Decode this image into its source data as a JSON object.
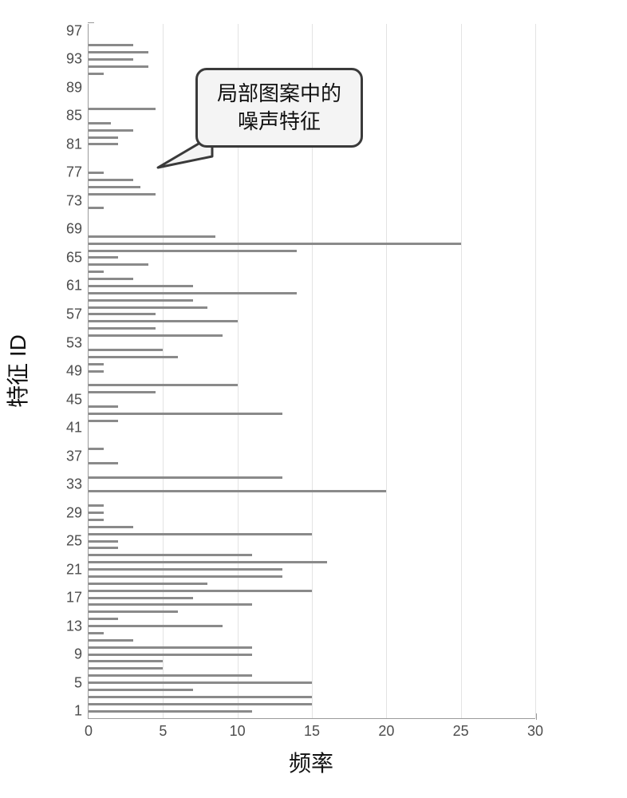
{
  "chart_data": {
    "type": "bar",
    "orientation": "horizontal",
    "title": "",
    "xlabel": "频率",
    "ylabel": "特征 ID",
    "xlim": [
      0,
      30
    ],
    "xticks": [
      0,
      5,
      10,
      15,
      20,
      25,
      30
    ],
    "ylim": [
      0,
      98
    ],
    "yticks": [
      1,
      5,
      9,
      13,
      17,
      21,
      25,
      29,
      33,
      37,
      41,
      45,
      49,
      53,
      57,
      61,
      65,
      69,
      73,
      77,
      81,
      85,
      89,
      93,
      97
    ],
    "series": [
      {
        "name": "frequency",
        "values": [
          {
            "id": 1,
            "v": 11
          },
          {
            "id": 2,
            "v": 15
          },
          {
            "id": 3,
            "v": 15
          },
          {
            "id": 4,
            "v": 7
          },
          {
            "id": 5,
            "v": 15
          },
          {
            "id": 6,
            "v": 11
          },
          {
            "id": 7,
            "v": 5
          },
          {
            "id": 8,
            "v": 5
          },
          {
            "id": 9,
            "v": 11
          },
          {
            "id": 10,
            "v": 11
          },
          {
            "id": 11,
            "v": 3
          },
          {
            "id": 12,
            "v": 1
          },
          {
            "id": 13,
            "v": 9
          },
          {
            "id": 14,
            "v": 2
          },
          {
            "id": 15,
            "v": 6
          },
          {
            "id": 16,
            "v": 11
          },
          {
            "id": 17,
            "v": 7
          },
          {
            "id": 18,
            "v": 15
          },
          {
            "id": 19,
            "v": 8
          },
          {
            "id": 20,
            "v": 13
          },
          {
            "id": 21,
            "v": 13
          },
          {
            "id": 22,
            "v": 16
          },
          {
            "id": 23,
            "v": 11
          },
          {
            "id": 24,
            "v": 2
          },
          {
            "id": 25,
            "v": 2
          },
          {
            "id": 26,
            "v": 15
          },
          {
            "id": 27,
            "v": 3
          },
          {
            "id": 28,
            "v": 1
          },
          {
            "id": 29,
            "v": 1
          },
          {
            "id": 30,
            "v": 1
          },
          {
            "id": 31,
            "v": 0
          },
          {
            "id": 32,
            "v": 20
          },
          {
            "id": 33,
            "v": 0
          },
          {
            "id": 34,
            "v": 13
          },
          {
            "id": 35,
            "v": 0
          },
          {
            "id": 36,
            "v": 2
          },
          {
            "id": 37,
            "v": 0
          },
          {
            "id": 38,
            "v": 1
          },
          {
            "id": 39,
            "v": 0
          },
          {
            "id": 40,
            "v": 0
          },
          {
            "id": 41,
            "v": 0
          },
          {
            "id": 42,
            "v": 2
          },
          {
            "id": 43,
            "v": 13
          },
          {
            "id": 44,
            "v": 2
          },
          {
            "id": 45,
            "v": 0
          },
          {
            "id": 46,
            "v": 4.5
          },
          {
            "id": 47,
            "v": 10
          },
          {
            "id": 48,
            "v": 0
          },
          {
            "id": 49,
            "v": 1
          },
          {
            "id": 50,
            "v": 1
          },
          {
            "id": 51,
            "v": 6
          },
          {
            "id": 52,
            "v": 5
          },
          {
            "id": 53,
            "v": 0
          },
          {
            "id": 54,
            "v": 9
          },
          {
            "id": 55,
            "v": 4.5
          },
          {
            "id": 56,
            "v": 10
          },
          {
            "id": 57,
            "v": 4.5
          },
          {
            "id": 58,
            "v": 8
          },
          {
            "id": 59,
            "v": 7
          },
          {
            "id": 60,
            "v": 14
          },
          {
            "id": 61,
            "v": 7
          },
          {
            "id": 62,
            "v": 3
          },
          {
            "id": 63,
            "v": 1
          },
          {
            "id": 64,
            "v": 4
          },
          {
            "id": 65,
            "v": 2
          },
          {
            "id": 66,
            "v": 14
          },
          {
            "id": 67,
            "v": 25
          },
          {
            "id": 68,
            "v": 8.5
          },
          {
            "id": 69,
            "v": 0
          },
          {
            "id": 70,
            "v": 0
          },
          {
            "id": 71,
            "v": 0
          },
          {
            "id": 72,
            "v": 1
          },
          {
            "id": 73,
            "v": 0
          },
          {
            "id": 74,
            "v": 4.5
          },
          {
            "id": 75,
            "v": 3.5
          },
          {
            "id": 76,
            "v": 3
          },
          {
            "id": 77,
            "v": 1
          },
          {
            "id": 78,
            "v": 0
          },
          {
            "id": 79,
            "v": 0
          },
          {
            "id": 80,
            "v": 0
          },
          {
            "id": 81,
            "v": 2
          },
          {
            "id": 82,
            "v": 2
          },
          {
            "id": 83,
            "v": 3
          },
          {
            "id": 84,
            "v": 1.5
          },
          {
            "id": 85,
            "v": 0
          },
          {
            "id": 86,
            "v": 4.5
          },
          {
            "id": 87,
            "v": 0
          },
          {
            "id": 88,
            "v": 0
          },
          {
            "id": 89,
            "v": 0
          },
          {
            "id": 90,
            "v": 0
          },
          {
            "id": 91,
            "v": 1
          },
          {
            "id": 92,
            "v": 4
          },
          {
            "id": 93,
            "v": 3
          },
          {
            "id": 94,
            "v": 4
          },
          {
            "id": 95,
            "v": 3
          },
          {
            "id": 96,
            "v": 0
          },
          {
            "id": 97,
            "v": 0
          }
        ]
      }
    ],
    "annotation": {
      "text_line1": "局部图案中的",
      "text_line2": "噪声特征",
      "points_to_ids": [
        81,
        82,
        83,
        84,
        85
      ]
    },
    "colors": {
      "bar": "#8a8a8a",
      "grid": "#e3e3e3",
      "axis": "#9a9a9a",
      "text": "#4d4d4d",
      "callout_bg": "#f4f4f4",
      "callout_border": "#3a3a3a"
    }
  }
}
